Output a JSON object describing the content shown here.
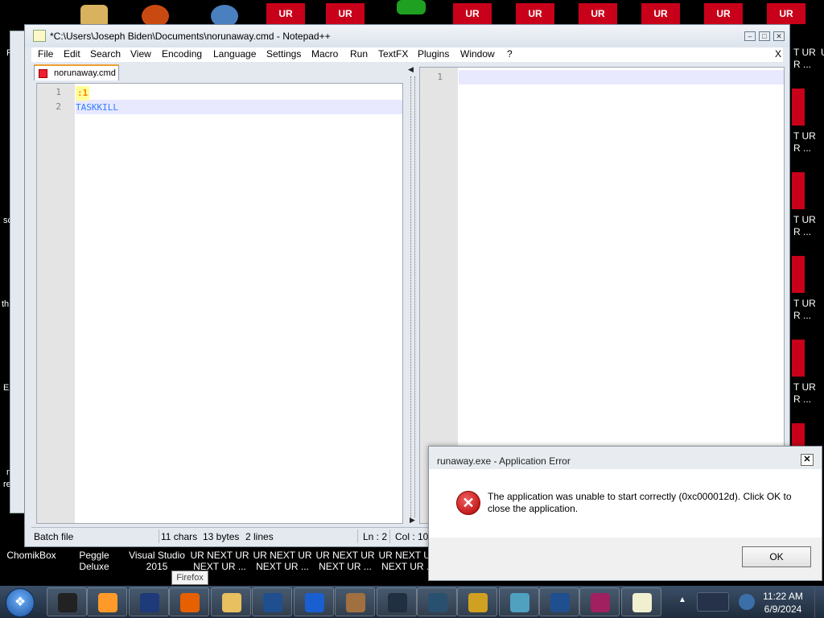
{
  "desktop": {
    "ur_tiles": [
      "UR",
      "UR",
      "UR",
      "UR",
      "UR",
      "UR",
      "UR",
      "UR",
      "UR"
    ],
    "right_labels": [
      "UR",
      "T UR",
      "R ...",
      "T UR",
      "R ...",
      "T UR",
      "R ...",
      "T UR",
      "R ...",
      "T UR",
      "R ..."
    ],
    "desktop_icons": [
      {
        "label": "ChomikBox"
      },
      {
        "label": "Peggle Deluxe"
      },
      {
        "label": "Visual Studio 2015"
      },
      {
        "label": "UR NEXT UR NEXT UR ..."
      },
      {
        "label": "UR NEXT UR NEXT UR ..."
      },
      {
        "label": "UR NEXT UR NEXT UR ..."
      },
      {
        "label": "UR NEXT UR NEXT UR ..."
      }
    ],
    "left_fragments": [
      "F",
      "sc",
      "th",
      "Er",
      "n",
      "re"
    ]
  },
  "notepad": {
    "title": "*C:\\Users\\Joseph Biden\\Documents\\norunaway.cmd - Notepad++",
    "menu": [
      "File",
      "Edit",
      "Search",
      "View",
      "Encoding",
      "Language",
      "Settings",
      "Macro",
      "Run",
      "TextFX",
      "Plugins",
      "Window",
      "?"
    ],
    "menu_close": "X",
    "tab_label": "norunaway.cmd",
    "left_editor": {
      "lines": [
        {
          "num": "1",
          "text": ":1"
        },
        {
          "num": "2",
          "text": "TASKKILL"
        }
      ]
    },
    "right_editor": {
      "lines": [
        {
          "num": "1",
          "text": ""
        }
      ]
    },
    "status": {
      "language": "Batch file",
      "chars": "11 chars",
      "bytes": "13 bytes",
      "lines": "2 lines",
      "ln": "Ln : 2",
      "col": "Col : 10"
    },
    "colors": {
      "label_bg": "#ffff99",
      "label_fg": "#ff8000",
      "keyword": "#2f80ff",
      "current_line": "#e8e8ff"
    }
  },
  "error_dialog": {
    "title": "runaway.exe - Application Error",
    "message": "The application was unable to start correctly (0xc000012d). Click OK to close the application.",
    "ok_label": "OK",
    "close_glyph": "✕",
    "icon_glyph": "✕"
  },
  "taskbar": {
    "tooltip": "Firefox",
    "clock_time": "11:22 AM",
    "clock_date": "6/9/2024",
    "apps": [
      {
        "icon": "terminal-icon",
        "color": "#222222"
      },
      {
        "icon": "media-player-icon",
        "color": "#ff9a2a"
      },
      {
        "icon": "globe-icon",
        "color": "#1e3a78"
      },
      {
        "icon": "firefox-icon",
        "color": "#e66000"
      },
      {
        "icon": "folder-icon",
        "color": "#e8c060"
      },
      {
        "icon": "tablet-icon",
        "color": "#1f4f8f"
      },
      {
        "icon": "malwarebytes-icon",
        "color": "#1a5fd0"
      },
      {
        "icon": "gopher-icon",
        "color": "#a07040"
      },
      {
        "icon": "monitor-icon",
        "color": "#203040"
      },
      {
        "icon": "screen-icon",
        "color": "#2a5070"
      },
      {
        "icon": "warning-icon",
        "color": "#d0a020"
      },
      {
        "icon": "cubes-icon",
        "color": "#50a0c0"
      },
      {
        "icon": "tablet-icon-2",
        "color": "#1f4f8f"
      },
      {
        "icon": "winrar-icon",
        "color": "#a02060"
      },
      {
        "icon": "notepad-icon",
        "color": "#f0f0d0"
      }
    ]
  }
}
